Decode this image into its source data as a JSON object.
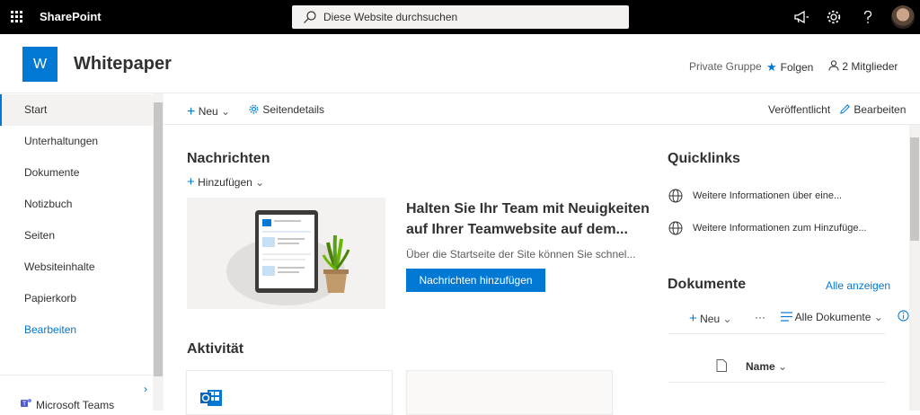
{
  "suite_bar": {
    "app_name": "SharePoint",
    "search_placeholder": "Diese Website durchsuchen",
    "icons": [
      "waffle-icon",
      "megaphone-icon",
      "settings-gear-icon",
      "help-icon",
      "avatar"
    ]
  },
  "site_header": {
    "logo_letter": "W",
    "title": "Whitepaper",
    "group_type": "Private Gruppe",
    "follow_label": "Folgen",
    "members_label": "2 Mitglieder",
    "accent_color": "#0078d4"
  },
  "left_nav": {
    "items": [
      {
        "label": "Start",
        "active": true
      },
      {
        "label": "Unterhaltungen"
      },
      {
        "label": "Dokumente"
      },
      {
        "label": "Notizbuch"
      },
      {
        "label": "Seiten"
      },
      {
        "label": "Websiteinhalte"
      },
      {
        "label": "Papierkorb"
      },
      {
        "label": "Bearbeiten",
        "link": true
      }
    ],
    "teams_label": "Microsoft Teams"
  },
  "command_bar": {
    "new_label": "Neu",
    "page_details_label": "Seitendetails",
    "status_label": "Veröffentlicht",
    "edit_label": "Bearbeiten"
  },
  "news": {
    "heading": "Nachrichten",
    "add_label": "Hinzufügen",
    "hero_title": "Halten Sie Ihr Team mit Neuigkeiten auf Ihrer Teamwebsite auf dem...",
    "hero_description": "Über die Startseite der Site können Sie schnel...",
    "hero_button": "Nachrichten hinzufügen"
  },
  "activity": {
    "heading": "Aktivität"
  },
  "quicklinks": {
    "heading": "Quicklinks",
    "links": [
      "Weitere Informationen über eine...",
      "Weitere Informationen zum Hinzufüge..."
    ]
  },
  "documents": {
    "heading": "Dokumente",
    "see_all": "Alle anzeigen",
    "new_label": "Neu",
    "more_label": "···",
    "view_label": "Alle Dokumente",
    "column_name": "Name"
  }
}
